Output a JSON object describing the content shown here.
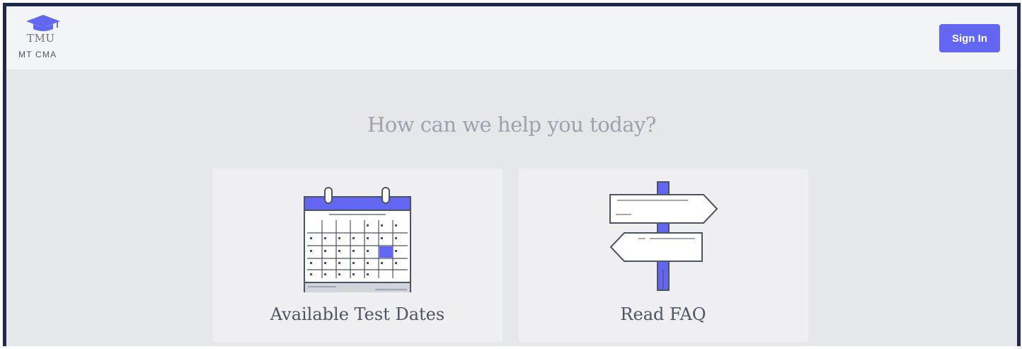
{
  "header": {
    "logo_text": "TMU",
    "org_name": "MT CMA",
    "signin_label": "Sign In"
  },
  "main": {
    "headline": "How can we help you today?",
    "cards": [
      {
        "label": "Available Test Dates",
        "icon": "calendar-icon"
      },
      {
        "label": "Read FAQ",
        "icon": "signpost-icon"
      }
    ]
  },
  "colors": {
    "accent": "#6366f1",
    "frame": "#1e2a4d",
    "header_bg": "#f3f4f6",
    "page_bg": "#e5e7eb",
    "card_bg": "#efeff2"
  }
}
